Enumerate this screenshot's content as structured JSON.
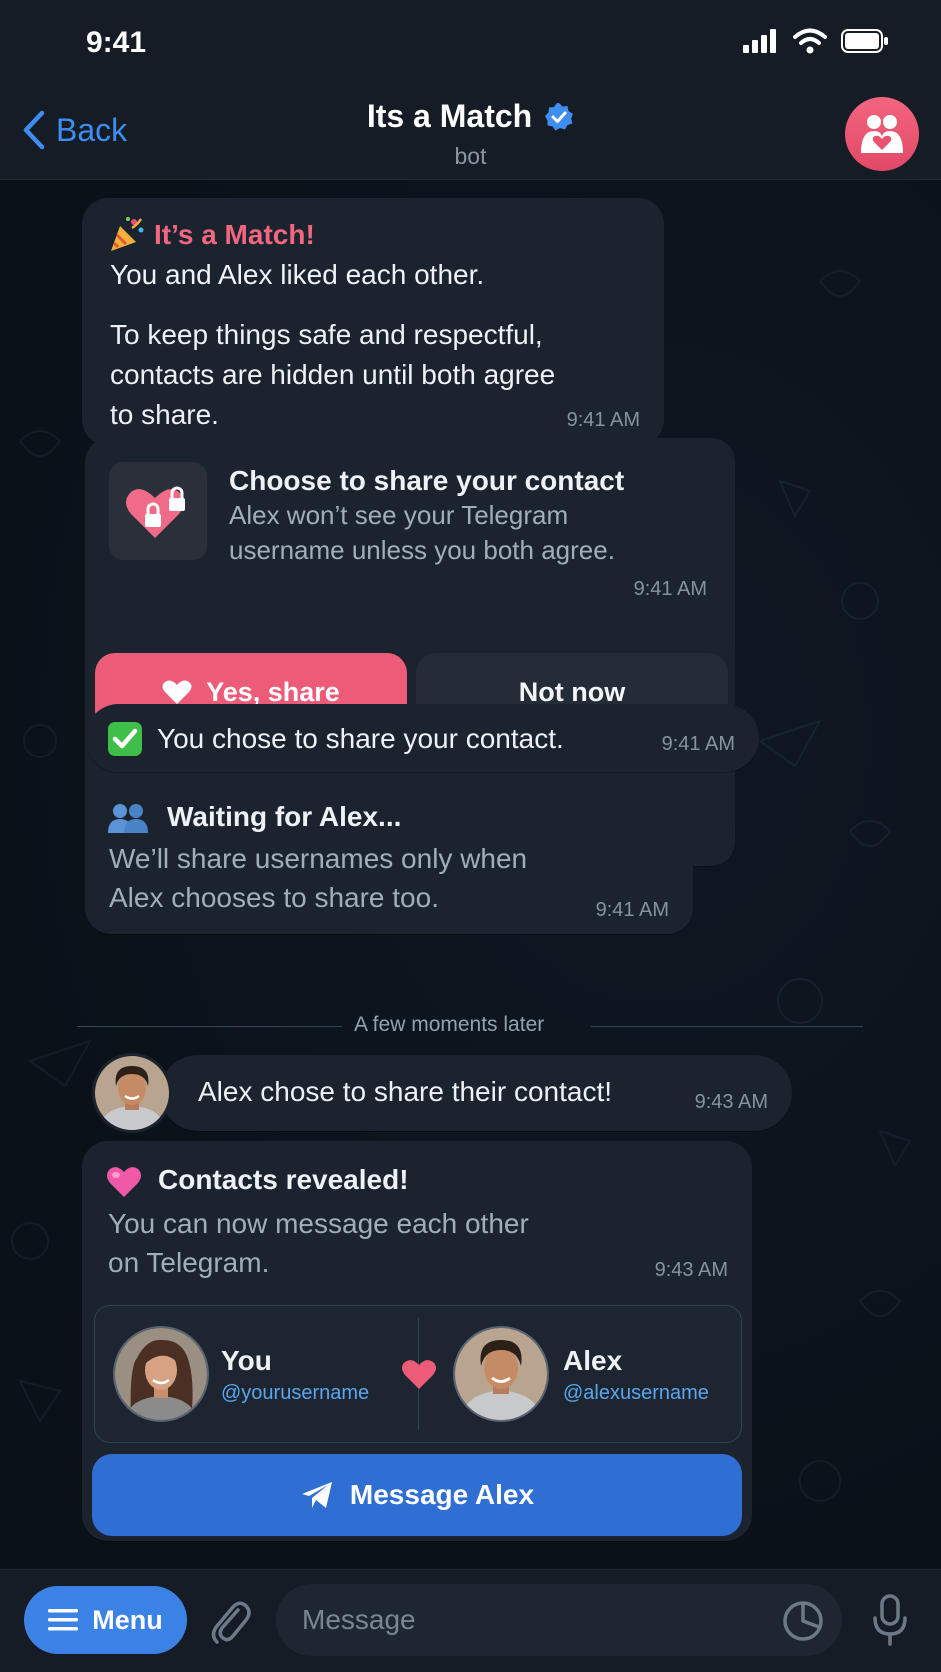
{
  "status_bar": {
    "time": "9:41"
  },
  "header": {
    "back_label": "Back",
    "title": "Its a Match",
    "subtitle": "bot",
    "accent_color": "#3d8ef0"
  },
  "messages": {
    "match": {
      "title": "It’s a Match!",
      "line1": "You and Alex liked each other.",
      "line2": "To keep things safe and respectful,",
      "line3": "contacts are hidden until both agree",
      "line4": "to share.",
      "time": "9:41 AM"
    },
    "choose": {
      "title": "Choose to share your contact",
      "line1": "Alex won’t see your Telegram",
      "line2": "username unless you both agree.",
      "time": "9:41 AM",
      "yes_label": "Yes, share",
      "no_label": "Not now"
    },
    "chose": {
      "text": "You chose to share your contact.",
      "time": "9:41 AM"
    },
    "waiting": {
      "title": "Waiting for Alex...",
      "line1": "We’ll share usernames only when",
      "line2": "Alex chooses to share too.",
      "time": "9:41 AM"
    },
    "divider": "A few moments later",
    "alex_shared": {
      "text": "Alex chose to share their contact!",
      "time": "9:43 AM"
    },
    "revealed": {
      "title": "Contacts revealed!",
      "line1": "You can now message each other",
      "line2": "on Telegram.",
      "time": "9:43 AM",
      "you_name": "You",
      "you_username": "@yourusername",
      "alex_name": "Alex",
      "alex_username": "@alexusername",
      "button_label": "Message Alex"
    }
  },
  "input_bar": {
    "menu_label": "Menu",
    "placeholder": "Message"
  },
  "colors": {
    "pink": "#f26680",
    "link": "#5aa6ee",
    "button_blue": "#2f6fd4"
  }
}
